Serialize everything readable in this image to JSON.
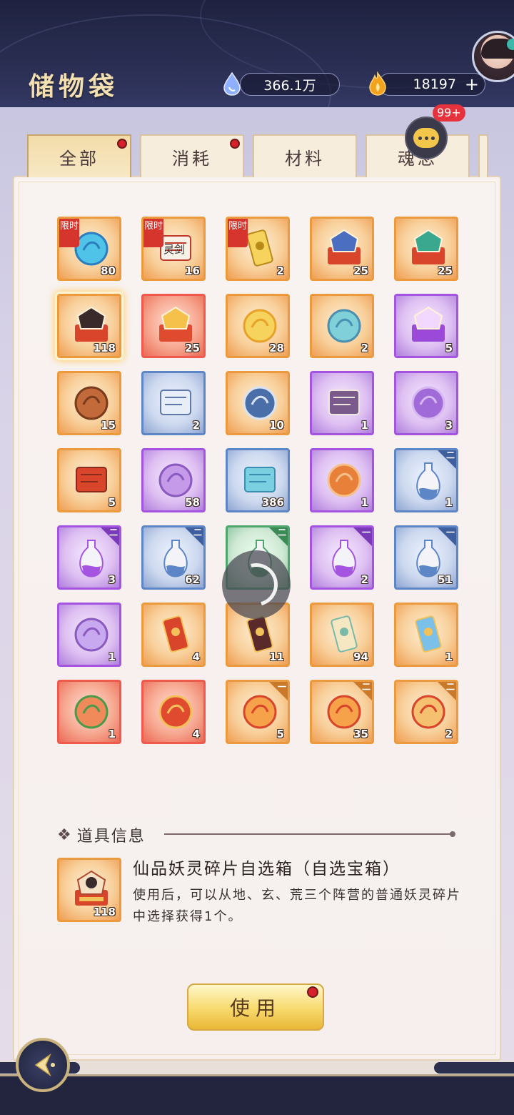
{
  "header": {
    "title": "储物袋",
    "currency_jade": "366.1万",
    "currency_gold": "18197",
    "plus": "+",
    "chat_badge": "99+"
  },
  "tabs": [
    {
      "label": "全部",
      "active": true,
      "dot": true
    },
    {
      "label": "消耗",
      "active": false,
      "dot": true
    },
    {
      "label": "材料",
      "active": false,
      "dot": false
    },
    {
      "label": "魂念",
      "active": false,
      "dot": false
    }
  ],
  "limit_label": "限时",
  "items": [
    {
      "count": "80",
      "quality": "orange",
      "limited": true,
      "art": "blue-flame"
    },
    {
      "count": "16",
      "quality": "orange",
      "limited": true,
      "art": "scroll-lingjian",
      "art_text": "灵剑"
    },
    {
      "count": "2",
      "quality": "orange",
      "limited": true,
      "art": "golden-ticket"
    },
    {
      "count": "25",
      "quality": "orange",
      "dot": true,
      "art": "red-chest"
    },
    {
      "count": "25",
      "quality": "orange",
      "dot": true,
      "art": "jade-chest"
    },
    {
      "count": "118",
      "quality": "orange",
      "dot": true,
      "selected": true,
      "art": "spirit-box"
    },
    {
      "count": "25",
      "quality": "red",
      "dot": true,
      "art": "red-box"
    },
    {
      "count": "28",
      "quality": "orange",
      "art": "golden-swirl"
    },
    {
      "count": "2",
      "quality": "orange",
      "art": "cyan-shoes"
    },
    {
      "count": "5",
      "quality": "purple",
      "art": "mystery-box"
    },
    {
      "count": "15",
      "quality": "orange",
      "art": "bronze-mirror"
    },
    {
      "count": "2",
      "quality": "blue",
      "art": "manual"
    },
    {
      "count": "10",
      "quality": "orange",
      "art": "sword-medal"
    },
    {
      "count": "1",
      "quality": "purple",
      "art": "brush-scroll"
    },
    {
      "count": "3",
      "quality": "purple",
      "art": "lotus-figure"
    },
    {
      "count": "5",
      "quality": "orange",
      "art": "red-scroll"
    },
    {
      "count": "58",
      "quality": "purple",
      "art": "silk-cloth"
    },
    {
      "count": "386",
      "quality": "blue",
      "art": "blue-scroll"
    },
    {
      "count": "1",
      "quality": "purple",
      "art": "fire-ring"
    },
    {
      "count": "1",
      "quality": "blue",
      "corner": "二",
      "art": "vase-blue"
    },
    {
      "count": "3",
      "quality": "purple",
      "corner": "二",
      "art": "vase-purple"
    },
    {
      "count": "62",
      "quality": "blue",
      "corner": "二",
      "art": "vase-blue"
    },
    {
      "count": "",
      "quality": "green",
      "corner": "二",
      "art": "vase-green"
    },
    {
      "count": "2",
      "quality": "purple",
      "corner": "一",
      "art": "vase-purple"
    },
    {
      "count": "51",
      "quality": "blue",
      "corner": "一",
      "art": "vase-blue"
    },
    {
      "count": "1",
      "quality": "purple",
      "art": "purple-gourd"
    },
    {
      "count": "4",
      "quality": "orange",
      "art": "red-talisman"
    },
    {
      "count": "11",
      "quality": "orange",
      "art": "dark-pendant"
    },
    {
      "count": "94",
      "quality": "orange",
      "art": "cloud-talisman"
    },
    {
      "count": "1",
      "quality": "orange",
      "art": "blue-talisman"
    },
    {
      "count": "1",
      "quality": "red",
      "art": "peach"
    },
    {
      "count": "4",
      "quality": "red",
      "art": "firecracker"
    },
    {
      "count": "5",
      "quality": "orange",
      "corner": "一",
      "art": "swirl-seal"
    },
    {
      "count": "35",
      "quality": "orange",
      "corner": "二",
      "art": "swirl-seal"
    },
    {
      "count": "2",
      "quality": "orange",
      "corner": "二",
      "art": "swirl-orb"
    }
  ],
  "info": {
    "section_title": "道具信息",
    "item_name": "仙品妖灵碎片自选箱（自选宝箱）",
    "item_desc": "使用后，可以从地、玄、荒三个阵营的普通妖灵碎片中选择获得1个。",
    "item_count": "118"
  },
  "use_button": "使用",
  "icons": {
    "jade": "jade-drop-icon",
    "gold": "gold-flame-icon",
    "chat": "chat-bubble-icon",
    "back": "back-arrow-icon",
    "swirl": "swirl-icon"
  },
  "colors": {
    "accent_gold": "#f7d96c",
    "badge_red": "#e5323c",
    "header_bg": "#1f2240"
  }
}
